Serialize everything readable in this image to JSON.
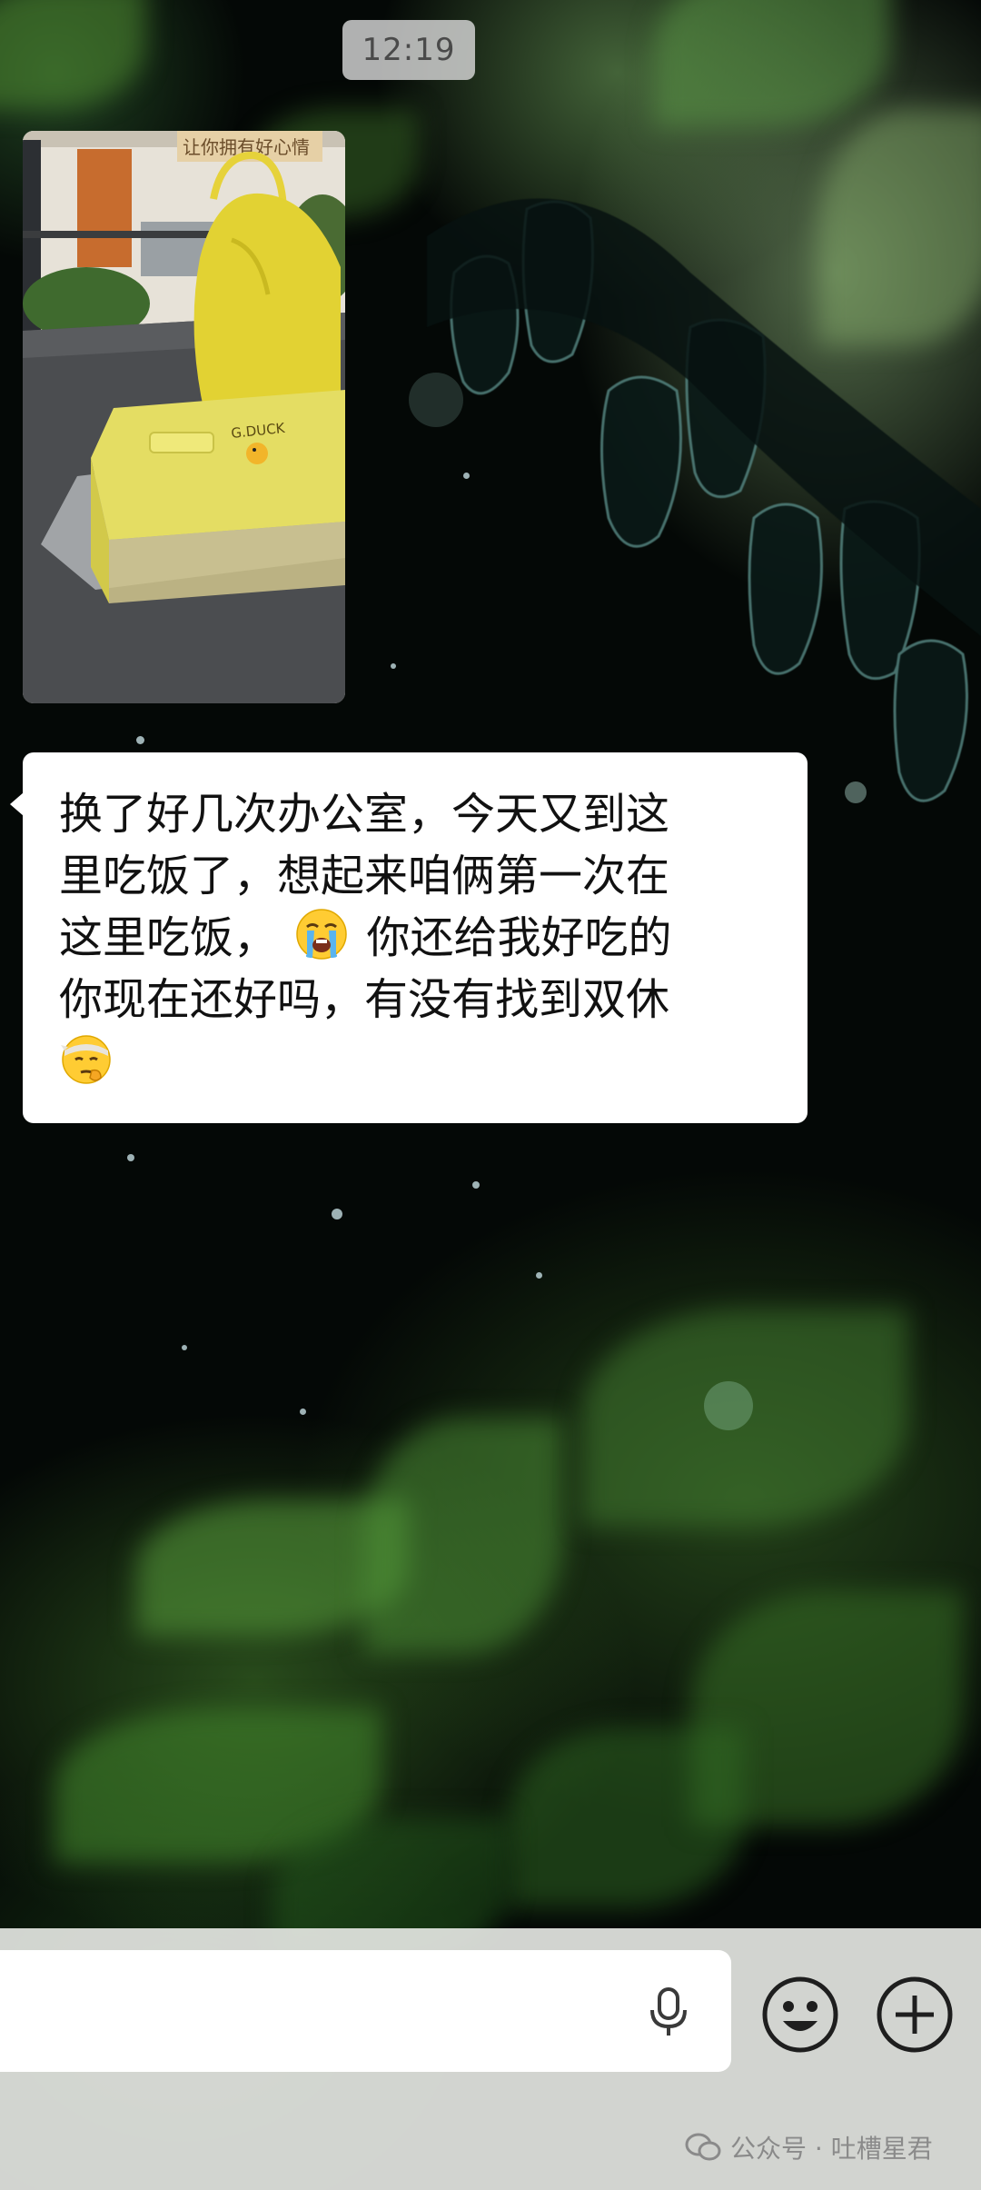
{
  "chat": {
    "timestamp": "12:19",
    "photo": {
      "box_label": "G.DUCK",
      "banner_text": "让你拥有好心情"
    },
    "message": {
      "line1": "换了好几次办公室，今天又到这",
      "line2": "里吃饭了，想起来咱俩第一次在",
      "line3_before_emoji": "这里吃饭，",
      "line3_after_emoji": "你还给我好吃的",
      "line4": "你现在还好吗，有没有找到双休",
      "emojis": [
        "loudly-crying-face",
        "thinking-face-with-headband"
      ]
    }
  },
  "input_bar": {
    "icons": [
      "microphone-icon",
      "smiley-icon",
      "plus-icon"
    ]
  },
  "watermark": {
    "text": "公众号 · 吐槽星君"
  },
  "colors": {
    "bubble": "#ffffff",
    "timestamp_bg": "#d7d7d7",
    "input_bar_bg": "#e4e6e2"
  }
}
